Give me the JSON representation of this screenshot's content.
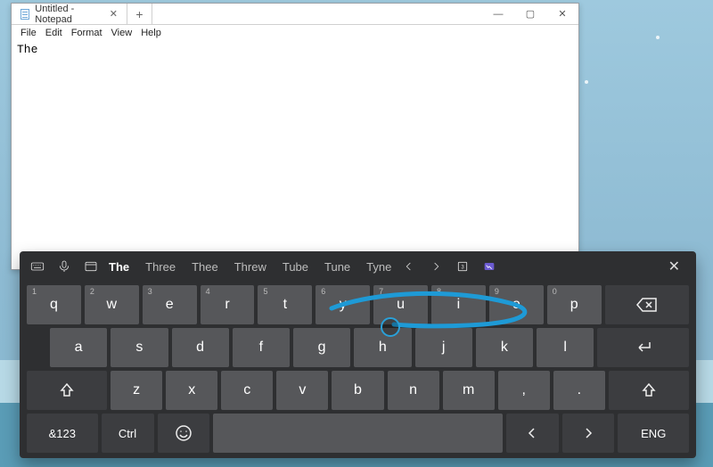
{
  "notepad": {
    "tab_title": "Untitled - Notepad",
    "menus": [
      "File",
      "Edit",
      "Format",
      "View",
      "Help"
    ],
    "content": "The"
  },
  "window_controls": {
    "min": "—",
    "max": "▢",
    "close": "✕"
  },
  "osk": {
    "suggestions": [
      "The",
      "Three",
      "Thee",
      "Threw",
      "Tube",
      "Tune",
      "Tyne"
    ],
    "close": "✕",
    "rows": {
      "r1_hints": [
        "1",
        "2",
        "3",
        "4",
        "5",
        "6",
        "7",
        "8",
        "9",
        "0"
      ],
      "r1": [
        "q",
        "w",
        "e",
        "r",
        "t",
        "y",
        "u",
        "i",
        "o",
        "p"
      ],
      "r2": [
        "a",
        "s",
        "d",
        "f",
        "g",
        "h",
        "j",
        "k",
        "l"
      ],
      "r3": [
        "z",
        "x",
        "c",
        "v",
        "b",
        "n",
        "m",
        ",",
        "."
      ],
      "bottom": {
        "numsym": "&123",
        "ctrl": "Ctrl",
        "lang": "ENG"
      }
    }
  }
}
